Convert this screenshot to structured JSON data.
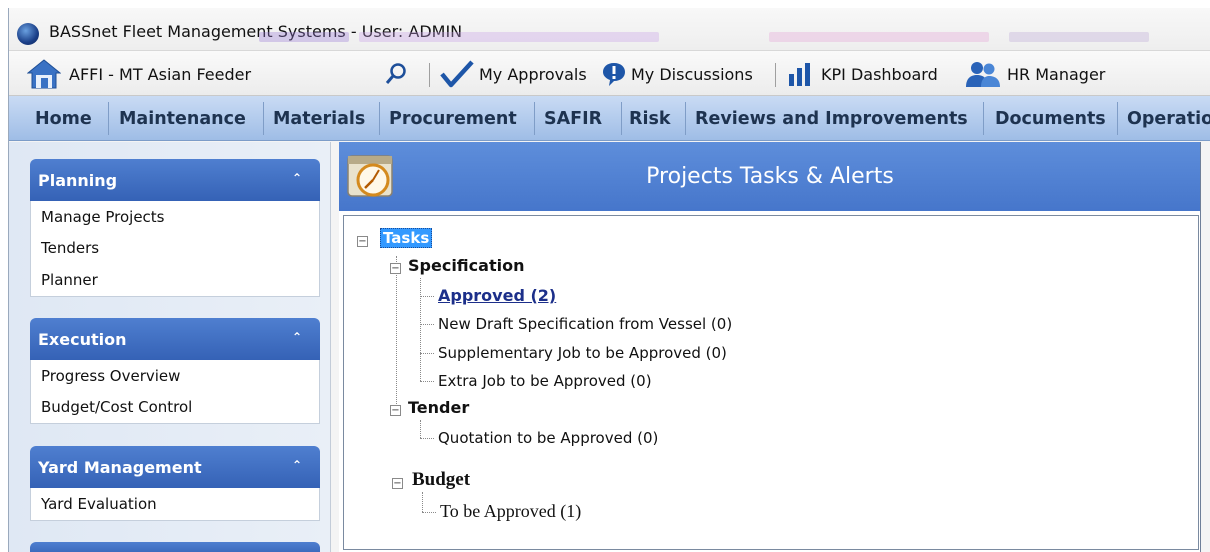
{
  "window": {
    "title": "BASSnet Fleet Management Systems - User: ADMIN"
  },
  "toolbar": {
    "vessel": "AFFI - MT Asian Feeder",
    "items": [
      {
        "icon": "search-icon",
        "label": ""
      },
      {
        "icon": "checkmark-icon",
        "label": "My Approvals"
      },
      {
        "icon": "exclamation-bubble-icon",
        "label": "My Discussions"
      },
      {
        "icon": "bar-chart-icon",
        "label": "KPI Dashboard"
      },
      {
        "icon": "people-icon",
        "label": "HR Manager"
      }
    ]
  },
  "menu": [
    "Home",
    "Maintenance",
    "Materials",
    "Procurement",
    "SAFIR",
    "Risk",
    "Reviews and Improvements",
    "Documents",
    "Operatio"
  ],
  "sidebar": {
    "sections": [
      {
        "title": "Planning",
        "items": [
          "Manage Projects",
          "Tenders",
          "Planner"
        ]
      },
      {
        "title": "Execution",
        "items": [
          "Progress Overview",
          "Budget/Cost Control"
        ]
      },
      {
        "title": "Yard Management",
        "items": [
          "Yard Evaluation"
        ]
      }
    ]
  },
  "main": {
    "title": "Projects Tasks & Alerts",
    "tree": {
      "root": "Tasks",
      "specification": {
        "label": "Specification",
        "items": [
          "Approved (2)",
          "New Draft Specification from Vessel (0)",
          "Supplementary Job to be Approved (0)",
          "Extra Job to be Approved (0)"
        ]
      },
      "tender": {
        "label": "Tender",
        "items": [
          "Quotation to be Approved (0)"
        ]
      },
      "budget": {
        "label": "Budget",
        "items": [
          "To be Approved (1)"
        ]
      }
    }
  },
  "colors": {
    "menu_bar": "#b3cbee",
    "panel_header": "#4676cb",
    "section_header": "#3f6fc4",
    "selection": "#3399ff"
  }
}
